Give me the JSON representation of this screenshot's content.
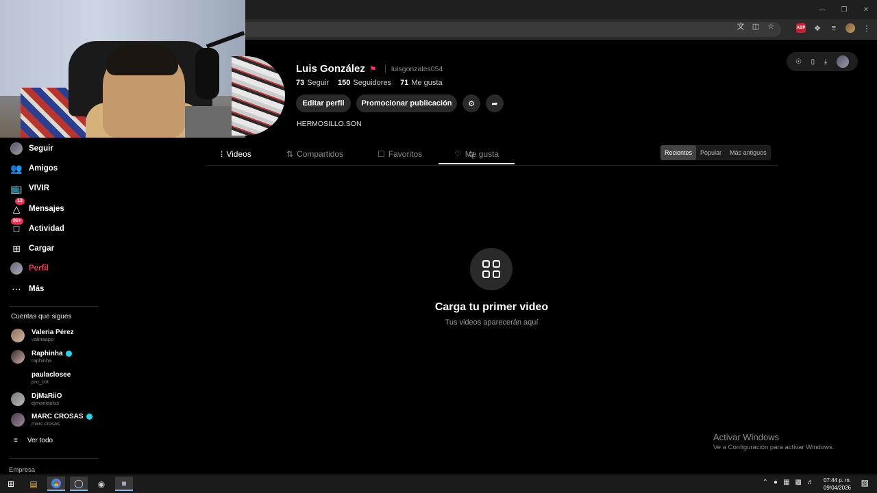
{
  "window": {
    "controls": [
      "minimize",
      "restore",
      "close"
    ]
  },
  "omnibox": {
    "icons": [
      "translate-icon",
      "install-icon",
      "star-icon"
    ]
  },
  "extensions": {
    "abp_label": "ABP"
  },
  "webcam": {
    "description_icon": "webcam-overlay"
  },
  "sidebar": {
    "items": [
      {
        "label": "Seguir",
        "icon": "avatar"
      },
      {
        "label": "Amigos",
        "icon": "friends-icon"
      },
      {
        "label": "VIVIR",
        "icon": "live-icon"
      },
      {
        "label": "Mensajes",
        "icon": "messages-icon",
        "badge": "13"
      },
      {
        "label": "Actividad",
        "icon": "activity-icon",
        "badge": "99+"
      },
      {
        "label": "Cargar",
        "icon": "upload-icon"
      },
      {
        "label": "Perfil",
        "icon": "profile-icon",
        "active": true
      },
      {
        "label": "Más",
        "icon": "more-icon"
      }
    ],
    "following_title": "Cuentas que sigues",
    "accounts": [
      {
        "name": "Valeria Pérez",
        "user": "valinaapp",
        "verified": false
      },
      {
        "name": "Raphinha",
        "user": "raphinha",
        "verified": true
      },
      {
        "name": "paulaclosee",
        "user": "pro_cttt",
        "verified": false
      },
      {
        "name": "DjMaRiiO",
        "user": "djmariioplus",
        "verified": false
      },
      {
        "name": "MARC CROSAS",
        "user": "marc.crosas",
        "verified": true
      }
    ],
    "see_all": "Ver todo",
    "footer": "Empresa"
  },
  "profile": {
    "name": "Luis González",
    "username": "luisgonzales054",
    "stats": [
      {
        "value": "73",
        "label": "Seguir"
      },
      {
        "value": "150",
        "label": "Seguidores"
      },
      {
        "value": "71",
        "label": "Me gusta"
      }
    ],
    "edit_label": "Editar perfil",
    "promote_label": "Promocionar publicación",
    "bio": "HERMOSILLO.SON"
  },
  "tabs": [
    {
      "label": "Videos",
      "active": true
    },
    {
      "label": "Compartidos"
    },
    {
      "label": "Favoritos"
    },
    {
      "label": "Me gusta",
      "underlined": true
    }
  ],
  "sort": [
    {
      "label": "Recientes",
      "selected": true
    },
    {
      "label": "Popular"
    },
    {
      "label": "Más antiguos"
    }
  ],
  "empty": {
    "title": "Carga tu primer video",
    "subtitle": "Tus videos aparecerán aquí"
  },
  "activation": {
    "title": "Activar Windows",
    "subtitle": "Ve a Configuración para activar Windows."
  },
  "taskbar": {
    "time": "07:44 p. m.",
    "date": "09/04/2026"
  }
}
